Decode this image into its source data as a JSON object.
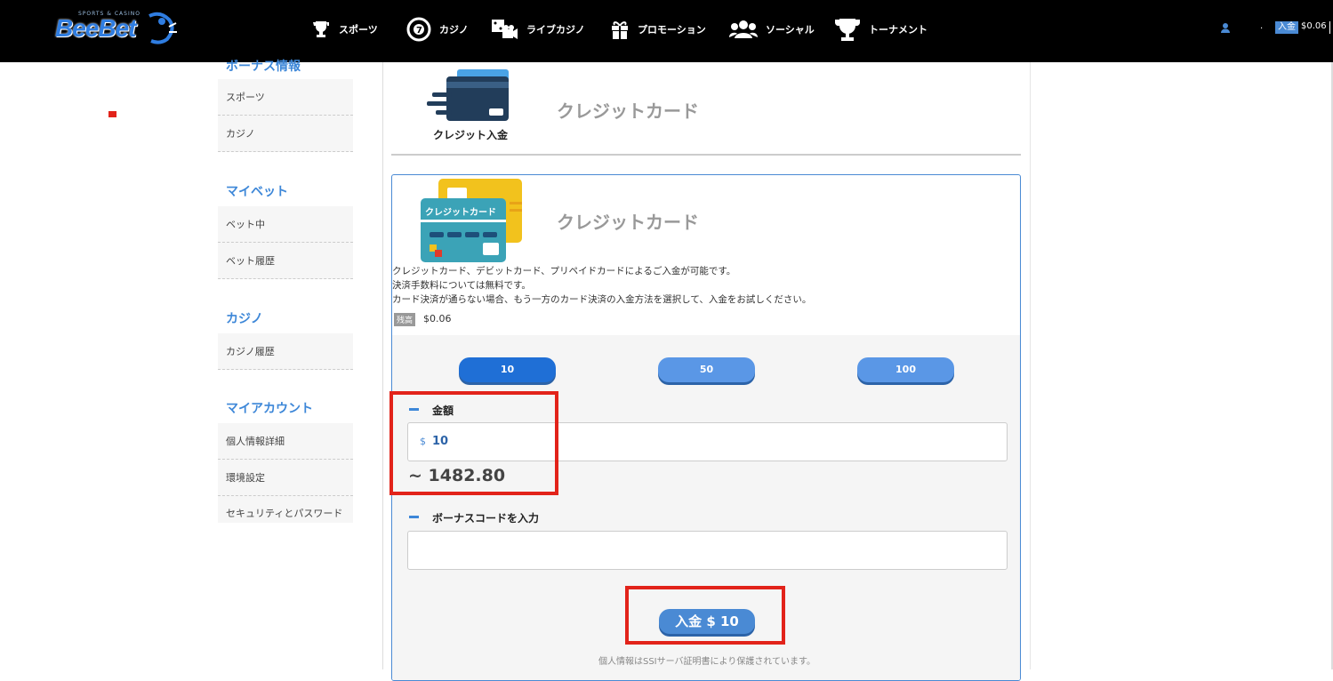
{
  "header": {
    "logo_text": "BeeBet",
    "logo_sub": "SPORTS & CASINO",
    "nav": [
      {
        "label": "スポーツ",
        "icon": "trophy-icon"
      },
      {
        "label": "カジノ",
        "icon": "roulette-icon"
      },
      {
        "label": "ライブカジノ",
        "icon": "dice-camera-icon"
      },
      {
        "label": "プロモーション",
        "icon": "gift-icon"
      },
      {
        "label": "ソーシャル",
        "icon": "users-icon"
      },
      {
        "label": "トーナメント",
        "icon": "cup-icon"
      }
    ],
    "account_dot": ".",
    "deposit_label": "入金",
    "balance": "$0.06",
    "separator": "|"
  },
  "sidebar": {
    "sections": [
      {
        "title": "ボーナス情報",
        "items": [
          "スポーツ",
          "カジノ"
        ]
      },
      {
        "title": "マイベット",
        "items": [
          "ベット中",
          "ベット履歴"
        ]
      },
      {
        "title": "カジノ",
        "items": [
          "カジノ履歴"
        ]
      },
      {
        "title": "マイアカウント",
        "items": [
          "個人情報詳細",
          "環境設定",
          "セキュリティとパスワード"
        ]
      }
    ]
  },
  "method": {
    "banner_caption": "クレジット入金",
    "title": "クレジットカード"
  },
  "panel": {
    "card_label": "クレジットカード",
    "title": "クレジットカード",
    "description": [
      "クレジットカード、デビットカード、プリペイドカードによるご入金が可能です。",
      "決済手数料については無料です。",
      "カード決済が通らない場合、もう一方のカード決済の入金方法を選択して、入金をお試しください。"
    ],
    "balance_tag": "残高",
    "balance_value": "$0.06",
    "presets": [
      "10",
      "50",
      "100"
    ],
    "amount_label": "金額",
    "currency_symbol": "$",
    "amount_value": "10",
    "converted": "~ 1482.80",
    "bonus_label": "ボーナスコードを入力",
    "bonus_value": "",
    "submit_label": "入金 $ 10",
    "security_note": "個人情報はSSIサーバ証明書により保護されています。"
  },
  "colors": {
    "accent": "#4a8ad4",
    "accent_dark": "#1f6fd6",
    "highlight": "#e2231a",
    "header_bg": "#000000"
  }
}
